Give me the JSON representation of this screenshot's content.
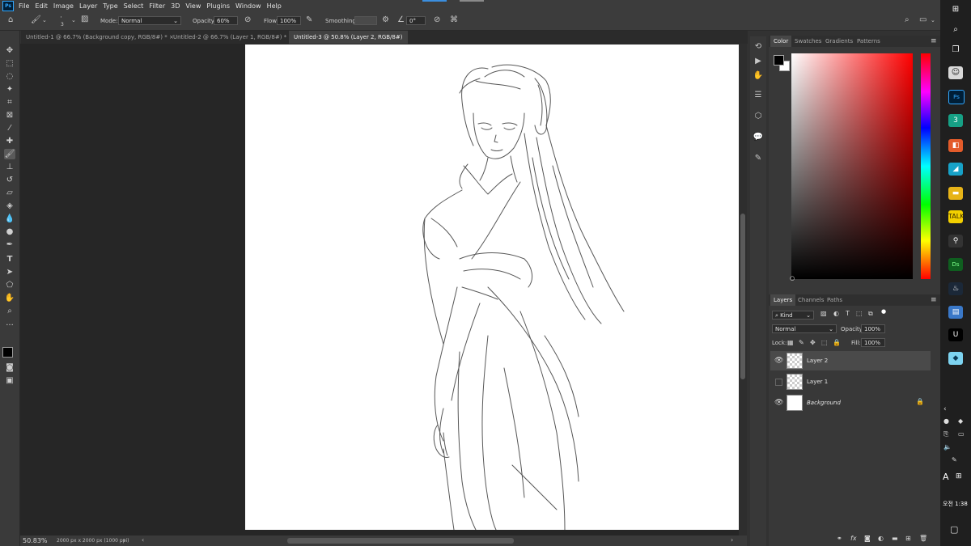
{
  "menu": [
    "File",
    "Edit",
    "Image",
    "Layer",
    "Type",
    "Select",
    "Filter",
    "3D",
    "View",
    "Plugins",
    "Window",
    "Help"
  ],
  "app_logo": "Ps",
  "options": {
    "brush_size": "3",
    "mode_label": "Mode:",
    "mode_value": "Normal",
    "opacity_label": "Opacity:",
    "opacity_value": "60%",
    "flow_label": "Flow:",
    "flow_value": "100%",
    "smoothing_label": "Smoothing:",
    "angle_value": "0°"
  },
  "tabs": [
    {
      "label": "Untitled-1 @ 66.7% (Background copy, RGB/8#) *"
    },
    {
      "label": "Untitled-2 @ 66.7% (Layer 1, RGB/8#) *"
    },
    {
      "label": "Untitled-3 @ 50.8% (Layer 2, RGB/8#) *"
    }
  ],
  "status": {
    "zoom": "50.83%",
    "doc_info": "2000 px x 2000 px (1000 ppi)"
  },
  "color_panel": {
    "tabs": [
      "Color",
      "Swatches",
      "Gradients",
      "Patterns"
    ],
    "foreground": "#000000",
    "background": "#ffffff"
  },
  "layers_panel": {
    "tabs": [
      "Layers",
      "Channels",
      "Paths"
    ],
    "filter_kind": "Kind",
    "blend_mode": "Normal",
    "opacity_label": "Opacity:",
    "opacity_value": "100%",
    "lock_label": "Lock:",
    "fill_label": "Fill:",
    "fill_value": "100%",
    "layers": [
      {
        "name": "Layer 2",
        "visible": true,
        "selected": true
      },
      {
        "name": "Layer 1",
        "visible": false,
        "selected": false
      },
      {
        "name": "Background",
        "visible": true,
        "selected": false,
        "locked": true
      }
    ]
  },
  "taskbar": {
    "ime": "A",
    "time_label": "오전 1:38"
  },
  "icons": {
    "search": "search-icon",
    "home": "home-icon",
    "brush": "brush-icon"
  }
}
